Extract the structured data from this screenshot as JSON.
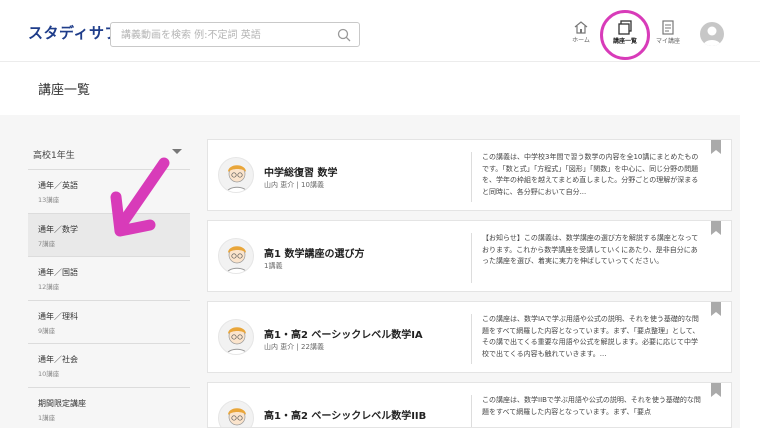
{
  "app": {
    "logo": "スタディサプリ"
  },
  "search": {
    "placeholder": "講義動画を検索 例:不定詞 英語"
  },
  "nav": {
    "home": "ホーム",
    "courses": "講座一覧",
    "my_courses": "マイ講座"
  },
  "page": {
    "title": "講座一覧"
  },
  "sidebar": {
    "grade": "高校1年生",
    "items": [
      {
        "name": "通年／英語",
        "count": "13講座"
      },
      {
        "name": "通年／数学",
        "count": "7講座"
      },
      {
        "name": "通年／国語",
        "count": "12講座"
      },
      {
        "name": "通年／理科",
        "count": "9講座"
      },
      {
        "name": "通年／社会",
        "count": "10講座"
      },
      {
        "name": "期間限定講座",
        "count": "1講座"
      }
    ]
  },
  "courses": [
    {
      "title": "中学総復習 数学",
      "meta": "山内 恵介 | 10講義",
      "desc": "この講義は、中学校3年間で習う数学の内容を全10講にまとめたものです。「数と式」「方程式」「図形」「関数」を中心に、同じ分野の問題を、学年の枠組を越えてまとめ直しました。分野ごとの理解が深まると同時に、各分野において自分..."
    },
    {
      "title": "高1 数学講座の選び方",
      "meta": "1講義",
      "desc": "【お知らせ】この講義は、数学講座の選び方を解説する講座となっております。これから数学講座を受講していくにあたり、是非自分にあった講座を選び、着実に実力を伸ばしていってください。"
    },
    {
      "title": "高1・高2 ベーシックレベル数学IA",
      "meta": "山内 恵介 | 22講義",
      "desc": "この講座は、数学IAで学ぶ用語や公式の説明、それを使う基礎的な問題をすべて網羅した内容となっています。まず、「要点整理」として、その講で出てくる重要な用語や公式を解説します。必要に応じて中学校で出てくる内容も触れていきます。..."
    },
    {
      "title": "高1・高2 ベーシックレベル数学IIB",
      "meta": "",
      "desc": "この講座は、数学IIBで学ぶ用語や公式の説明、それを使う基礎的な問題をすべて網羅した内容となっています。まず、「要点"
    }
  ],
  "colors": {
    "highlight": "#d83bb9",
    "logo": "#1f3d8a"
  }
}
